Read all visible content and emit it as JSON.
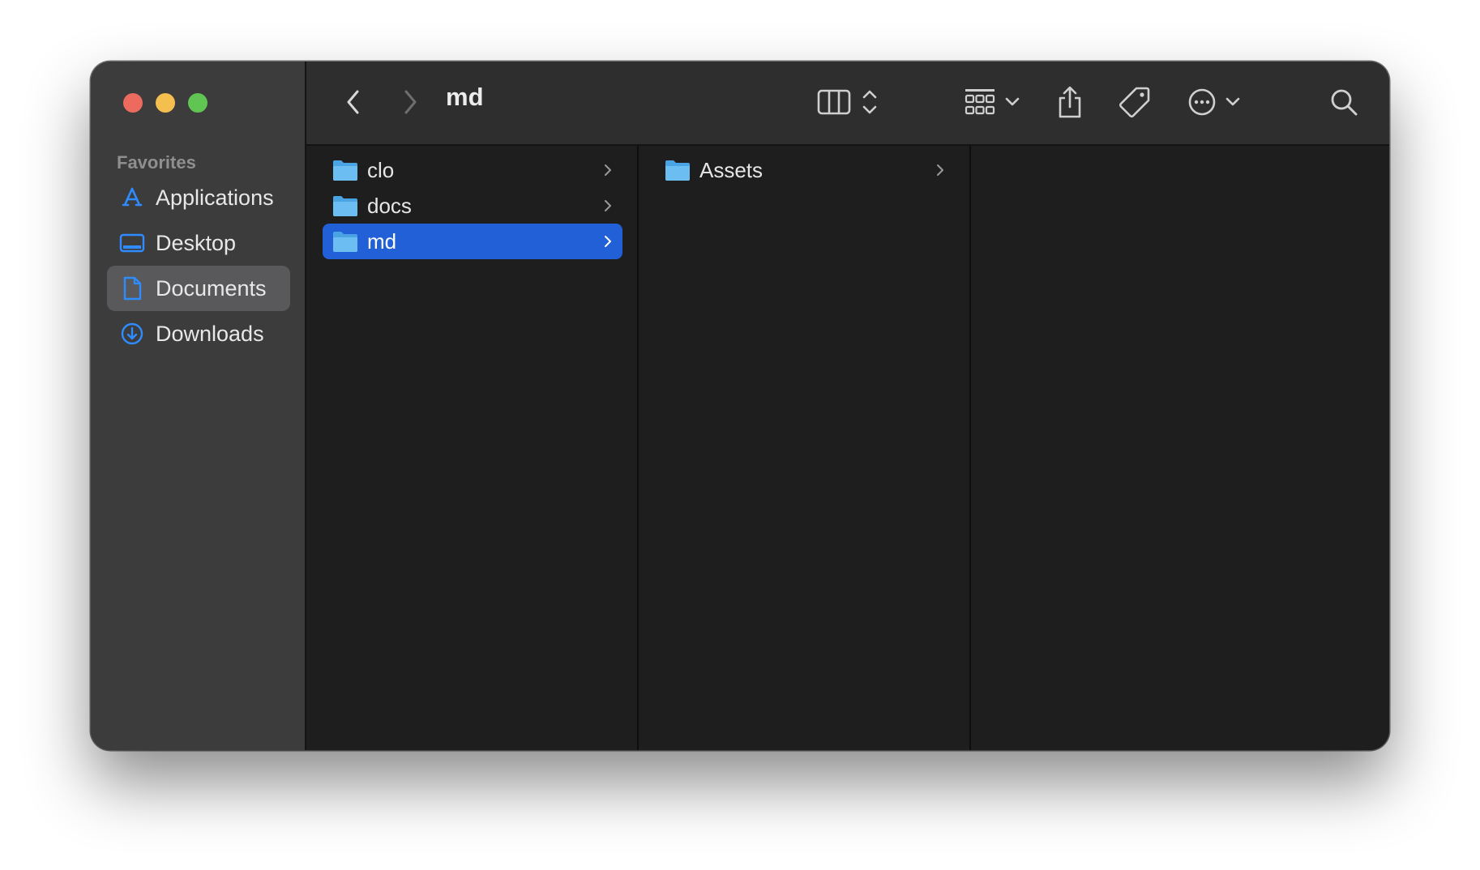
{
  "window": {
    "title": "md"
  },
  "sidebar": {
    "section_label": "Favorites",
    "items": [
      {
        "label": "Applications",
        "icon": "applications-icon",
        "selected": false
      },
      {
        "label": "Desktop",
        "icon": "desktop-icon",
        "selected": false
      },
      {
        "label": "Documents",
        "icon": "documents-icon",
        "selected": true
      },
      {
        "label": "Downloads",
        "icon": "downloads-icon",
        "selected": false
      }
    ]
  },
  "toolbar": {
    "buttons": [
      "back-icon",
      "forward-icon",
      "column-view-icon",
      "view-options-chevron-icon",
      "group-icon",
      "share-icon",
      "tag-icon",
      "more-icon",
      "search-icon"
    ]
  },
  "columns": [
    {
      "items": [
        {
          "label": "clo",
          "selected": false
        },
        {
          "label": "docs",
          "selected": false
        },
        {
          "label": "md",
          "selected": true
        }
      ]
    },
    {
      "items": [
        {
          "label": "Assets",
          "selected": false
        }
      ]
    },
    {
      "items": []
    }
  ],
  "colors": {
    "accent_selection": "#2160d6",
    "sidebar_icon_blue": "#2f8cff",
    "folder_blue": "#5ab0ea",
    "close": "#ed6a5e",
    "minimize": "#f5bf4f",
    "maximize": "#61c554"
  }
}
